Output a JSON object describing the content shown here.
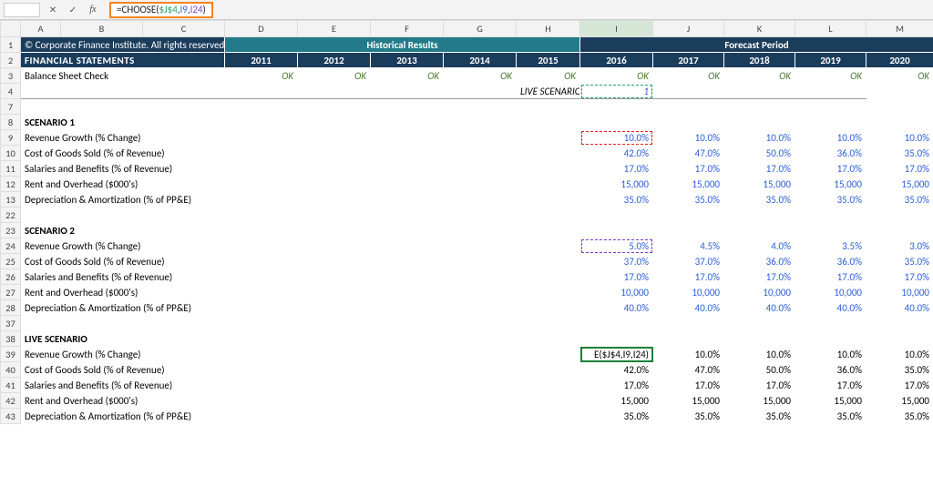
{
  "formula_bar": {
    "name_box": "",
    "cancel": "✕",
    "confirm": "✓",
    "fx": "fx",
    "parts": {
      "prefix": "=CHOOSE(",
      "arg1": "$J$4",
      "c1": ",",
      "arg2": "I9",
      "c2": ",",
      "arg3": "I24",
      "suffix": ")"
    }
  },
  "cols": [
    "A",
    "B",
    "C",
    "D",
    "E",
    "F",
    "G",
    "H",
    "I",
    "J",
    "K",
    "L",
    "M"
  ],
  "row_nums": [
    "1",
    "2",
    "3",
    "4",
    "7",
    "8",
    "9",
    "10",
    "11",
    "12",
    "13",
    "22",
    "23",
    "24",
    "25",
    "26",
    "27",
    "28",
    "37",
    "38",
    "39",
    "40",
    "41",
    "42",
    "43"
  ],
  "header": {
    "copyright": "© Corporate Finance Institute. All rights reserved.",
    "title": "FINANCIAL STATEMENTS",
    "hist_title": "Historical Results",
    "fore_title": "Forecast Period",
    "years": [
      "2011",
      "2012",
      "2013",
      "2014",
      "2015",
      "2016",
      "2017",
      "2018",
      "2019",
      "2020"
    ]
  },
  "r3": {
    "label": "Balance Sheet Check",
    "oks": [
      "OK",
      "OK",
      "OK",
      "OK",
      "OK",
      "OK",
      "OK",
      "OK",
      "OK",
      "OK"
    ]
  },
  "r4": {
    "label": "LIVE SCENARIO",
    "value": "1"
  },
  "scen1": {
    "title": "SCENARIO 1",
    "rows": [
      {
        "label": "Revenue Growth (% Change)",
        "vals": [
          "10.0%",
          "10.0%",
          "10.0%",
          "10.0%",
          "10.0%"
        ]
      },
      {
        "label": "Cost of Goods Sold (% of Revenue)",
        "vals": [
          "42.0%",
          "47.0%",
          "50.0%",
          "36.0%",
          "35.0%"
        ]
      },
      {
        "label": "Salaries and Benefits (% of Revenue)",
        "vals": [
          "17.0%",
          "17.0%",
          "17.0%",
          "17.0%",
          "17.0%"
        ]
      },
      {
        "label": "Rent and Overhead ($000's)",
        "vals": [
          "15,000",
          "15,000",
          "15,000",
          "15,000",
          "15,000"
        ]
      },
      {
        "label": "Depreciation & Amortization (% of PP&E)",
        "vals": [
          "35.0%",
          "35.0%",
          "35.0%",
          "35.0%",
          "35.0%"
        ]
      }
    ]
  },
  "scen2": {
    "title": "SCENARIO 2",
    "rows": [
      {
        "label": "Revenue Growth (% Change)",
        "vals": [
          "5.0%",
          "4.5%",
          "4.0%",
          "3.5%",
          "3.0%"
        ]
      },
      {
        "label": "Cost of Goods Sold (% of Revenue)",
        "vals": [
          "37.0%",
          "37.0%",
          "36.0%",
          "36.0%",
          "35.0%"
        ]
      },
      {
        "label": "Salaries and Benefits (% of Revenue)",
        "vals": [
          "17.0%",
          "17.0%",
          "17.0%",
          "17.0%",
          "17.0%"
        ]
      },
      {
        "label": "Rent and Overhead ($000's)",
        "vals": [
          "10,000",
          "10,000",
          "10,000",
          "10,000",
          "10,000"
        ]
      },
      {
        "label": "Depreciation & Amortization (% of PP&E)",
        "vals": [
          "40.0%",
          "40.0%",
          "40.0%",
          "40.0%",
          "40.0%"
        ]
      }
    ]
  },
  "live": {
    "title": "LIVE SCENARIO",
    "rows": [
      {
        "label": "Revenue Growth (% Change)",
        "first_formula": "E($J$4,I9,I24)",
        "vals": [
          "",
          "10.0%",
          "10.0%",
          "10.0%",
          "10.0%"
        ]
      },
      {
        "label": "Cost of Goods Sold (% of Revenue)",
        "vals": [
          "42.0%",
          "47.0%",
          "50.0%",
          "36.0%",
          "35.0%"
        ]
      },
      {
        "label": "Salaries and Benefits (% of Revenue)",
        "vals": [
          "17.0%",
          "17.0%",
          "17.0%",
          "17.0%",
          "17.0%"
        ]
      },
      {
        "label": "Rent and Overhead ($000's)",
        "vals": [
          "15,000",
          "15,000",
          "15,000",
          "15,000",
          "15,000"
        ]
      },
      {
        "label": "Depreciation & Amortization (% of PP&E)",
        "vals": [
          "35.0%",
          "35.0%",
          "35.0%",
          "35.0%",
          "35.0%"
        ]
      }
    ]
  }
}
